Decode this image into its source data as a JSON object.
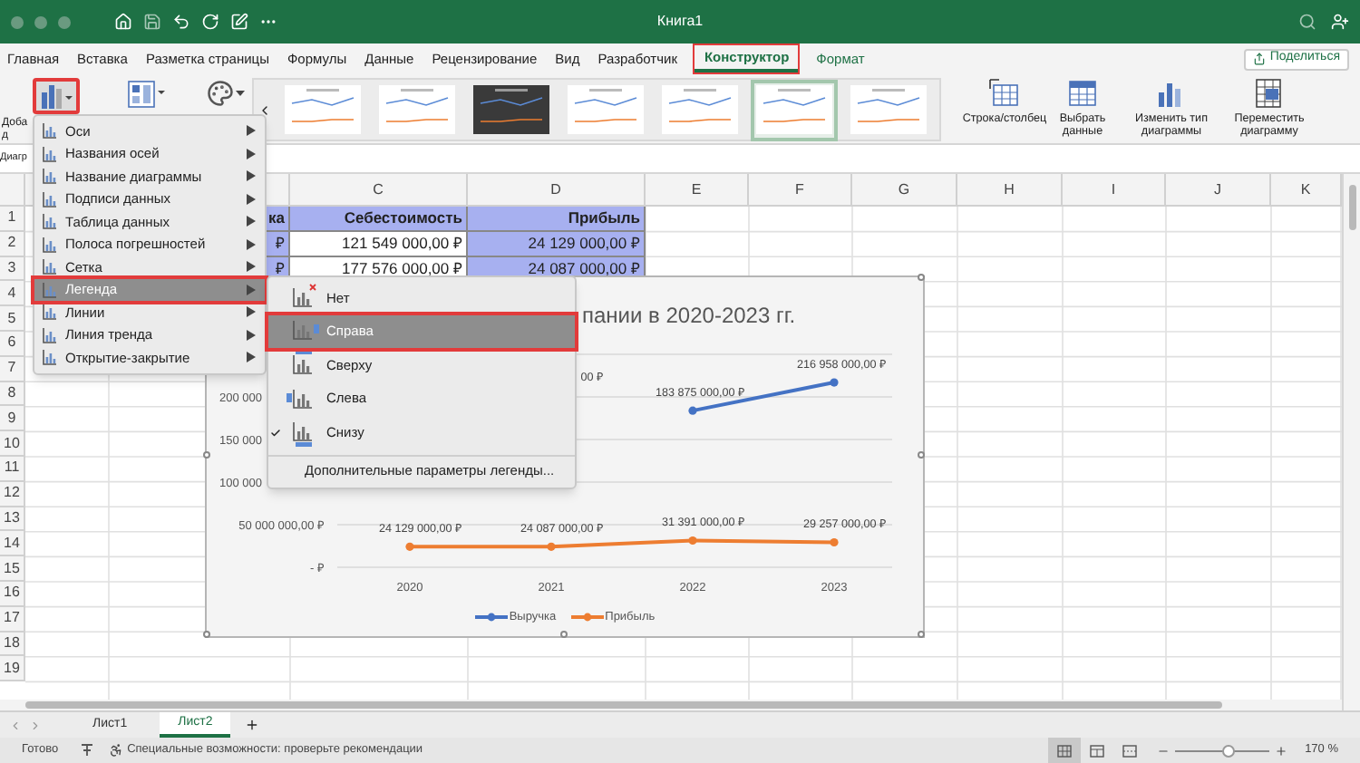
{
  "window": {
    "title": "Книга1"
  },
  "ribbon_tabs": [
    {
      "label": "Главная",
      "selected": false,
      "contextual": false,
      "highlighted": false
    },
    {
      "label": "Вставка",
      "selected": false,
      "contextual": false,
      "highlighted": false
    },
    {
      "label": "Разметка страницы",
      "selected": false,
      "contextual": false,
      "highlighted": false
    },
    {
      "label": "Формулы",
      "selected": false,
      "contextual": false,
      "highlighted": false
    },
    {
      "label": "Данные",
      "selected": false,
      "contextual": false,
      "highlighted": false
    },
    {
      "label": "Рецензирование",
      "selected": false,
      "contextual": false,
      "highlighted": false
    },
    {
      "label": "Вид",
      "selected": false,
      "contextual": false,
      "highlighted": false
    },
    {
      "label": "Разработчик",
      "selected": false,
      "contextual": false,
      "highlighted": false
    },
    {
      "label": "Конструктор",
      "selected": true,
      "contextual": true,
      "highlighted": true
    },
    {
      "label": "Формат",
      "selected": false,
      "contextual": true,
      "highlighted": false
    }
  ],
  "share_button": {
    "label": "Поделиться"
  },
  "ribbon": {
    "add_chart_element": {
      "label_lines": [
        "Доба",
        "д"
      ],
      "highlighted": true
    },
    "chart_styles": [
      {
        "kind": "light",
        "selected": false
      },
      {
        "kind": "light",
        "selected": false
      },
      {
        "kind": "dark",
        "selected": false
      },
      {
        "kind": "light",
        "selected": false
      },
      {
        "kind": "light",
        "selected": false
      },
      {
        "kind": "light",
        "selected": true
      },
      {
        "kind": "light",
        "selected": false
      }
    ],
    "buttons": [
      {
        "label": "Строка/столбец",
        "kind": "switch"
      },
      {
        "label": "Выбрать данные",
        "kind": "data"
      },
      {
        "label": "Изменить тип диаграммы",
        "kind": "chart-type"
      },
      {
        "label": "Переместить диаграмму",
        "kind": "move"
      }
    ]
  },
  "name_box": "Диагр",
  "sheet": {
    "columns": [
      "C",
      "D",
      "E",
      "F",
      "G",
      "H",
      "I",
      "J",
      "K"
    ],
    "rows": [
      "1",
      "2",
      "3",
      "4",
      "5",
      "6",
      "7",
      "8",
      "9",
      "10",
      "11",
      "12",
      "13",
      "14",
      "15",
      "16",
      "17",
      "18",
      "19"
    ],
    "cells": [
      [
        "ка",
        "Себестоимость",
        "Прибыль"
      ],
      [
        "₽",
        "121 549 000,00 ₽",
        "24 129 000,00 ₽"
      ],
      [
        "₽",
        "177 576 000,00 ₽",
        "24 087 000,00 ₽"
      ]
    ]
  },
  "chart": {
    "chart_data": {
      "type": "line",
      "title": "пании в 2020-2023 гг.",
      "categories": [
        "2020",
        "2021",
        "2022",
        "2023"
      ],
      "series": [
        {
          "name": "Выручка",
          "color": "#4472c4",
          "marker": "circle",
          "values": [
            null,
            null,
            183875000,
            216958000
          ],
          "value_labels": [
            null,
            null,
            "183 875 000,00 ₽",
            "216 958 000,00 ₽"
          ]
        },
        {
          "name": "Прибыль",
          "color": "#ed7d31",
          "marker": "circle",
          "values": [
            24129000,
            24087000,
            31391000,
            29257000
          ],
          "value_labels": [
            "24 129 000,00 ₽",
            "24 087 000,00 ₽",
            "31 391 000,00 ₽",
            "29 257 000,00 ₽"
          ]
        }
      ],
      "legend": "bottom",
      "annotations": [
        "00 ₽"
      ]
    },
    "cut_axis_labels": [
      "200 000",
      "150 000",
      "100 000"
    ],
    "axis_labels": [
      "50 000 000,00 ₽",
      "- ₽"
    ]
  },
  "menu": {
    "items": [
      {
        "label": "Оси",
        "selected": false,
        "highlighted": false
      },
      {
        "label": "Названия осей",
        "selected": false,
        "highlighted": false
      },
      {
        "label": "Название диаграммы",
        "selected": false,
        "highlighted": false
      },
      {
        "label": "Подписи данных",
        "selected": false,
        "highlighted": false
      },
      {
        "label": "Таблица данных",
        "selected": false,
        "highlighted": false
      },
      {
        "label": "Полоса погрешностей",
        "selected": false,
        "highlighted": false
      },
      {
        "label": "Сетка",
        "selected": false,
        "highlighted": false
      },
      {
        "label": "Легенда",
        "selected": true,
        "highlighted": true
      },
      {
        "label": "Линии",
        "selected": false,
        "highlighted": false
      },
      {
        "label": "Линия тренда",
        "selected": false,
        "highlighted": false
      },
      {
        "label": "Открытие-закрытие",
        "selected": false,
        "highlighted": false
      }
    ]
  },
  "submenu": {
    "items": [
      {
        "label": "Нет",
        "kind": "none",
        "selected": false,
        "highlighted": false,
        "checked": false
      },
      {
        "label": "Справа",
        "kind": "right",
        "selected": true,
        "highlighted": true,
        "checked": false
      },
      {
        "label": "Сверху",
        "kind": "top",
        "selected": false,
        "highlighted": false,
        "checked": false
      },
      {
        "label": "Слева",
        "kind": "left",
        "selected": false,
        "highlighted": false,
        "checked": false
      },
      {
        "label": "Снизу",
        "kind": "bottom",
        "selected": false,
        "highlighted": false,
        "checked": true
      }
    ],
    "more": "Дополнительные параметры легенды..."
  },
  "sheet_tabs": [
    {
      "label": "Лист1",
      "selected": false
    },
    {
      "label": "Лист2",
      "selected": true
    }
  ],
  "status_bar": {
    "ready": "Готово",
    "accessibility": "Специальные возможности: проверьте рекомендации",
    "views": [
      {
        "kind": "normal",
        "selected": true
      },
      {
        "kind": "page-layout",
        "selected": false
      },
      {
        "kind": "page-break",
        "selected": false
      }
    ],
    "zoom": {
      "level": 0.57,
      "reading": "170 %"
    }
  }
}
